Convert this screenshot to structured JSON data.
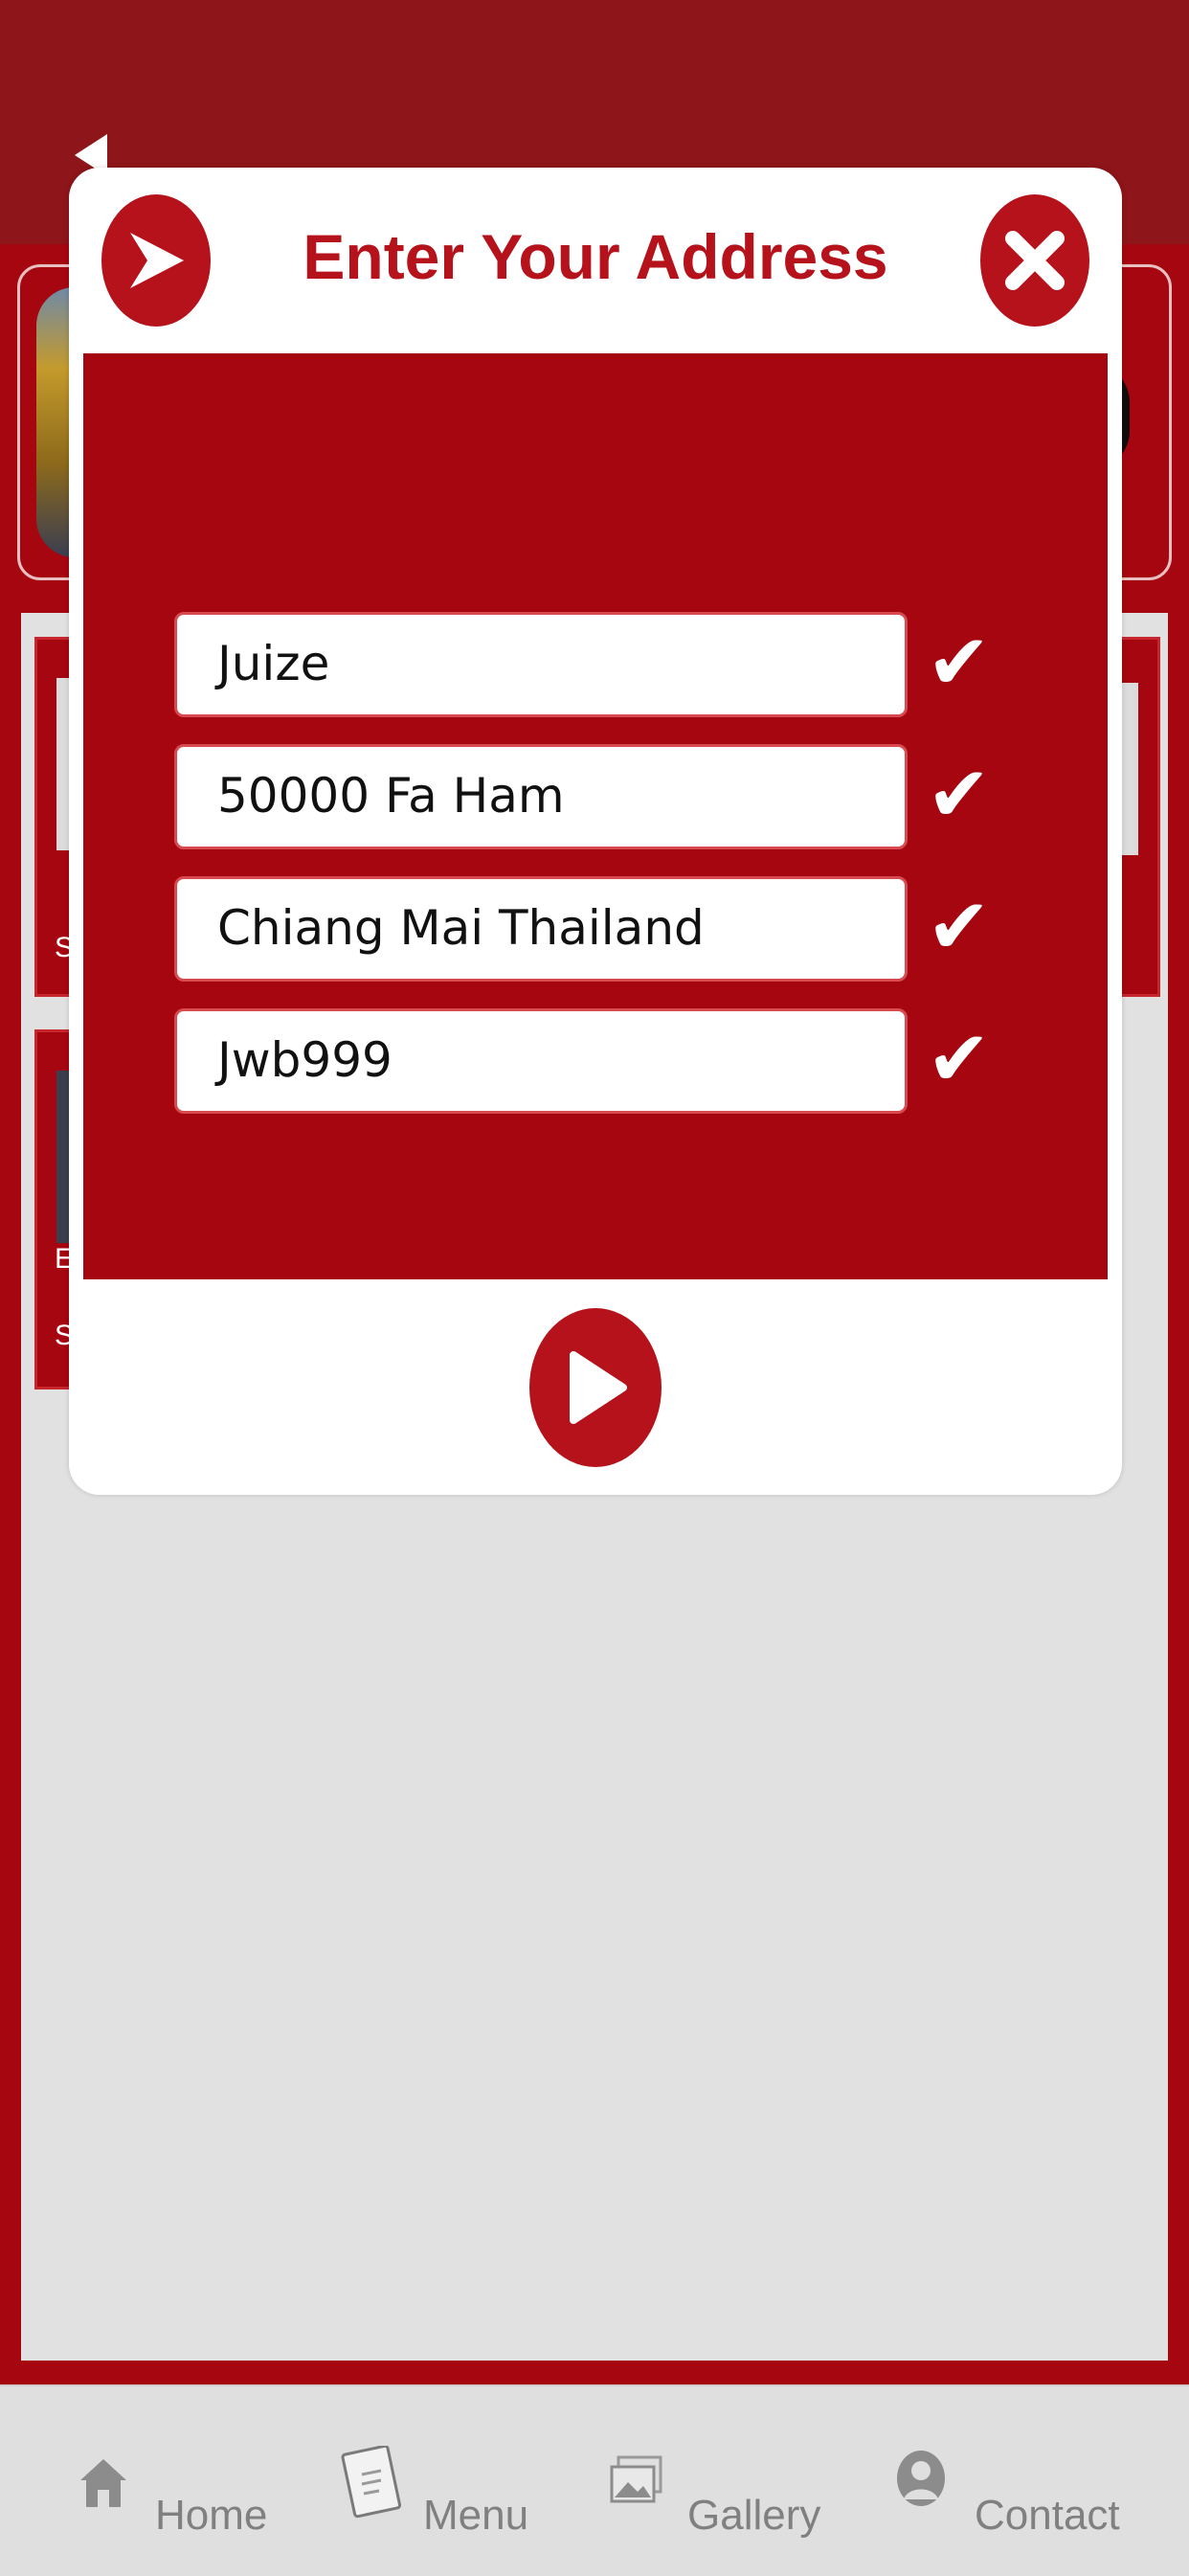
{
  "modal": {
    "title": "Enter Your Address",
    "fields": [
      {
        "value": "Juize"
      },
      {
        "value": "50000 Fa Ham"
      },
      {
        "value": "Chiang Mai Thailand"
      },
      {
        "value": "Jwb999"
      }
    ],
    "check_glyph": "✔"
  },
  "tabbar": {
    "items": [
      {
        "label": "Home",
        "icon": "home-icon"
      },
      {
        "label": "Menu",
        "icon": "menu-book-icon"
      },
      {
        "label": "Gallery",
        "icon": "gallery-icon"
      },
      {
        "label": "Contact",
        "icon": "contact-icon"
      }
    ]
  },
  "background": {
    "card_letters": [
      "S",
      "E",
      "S"
    ]
  },
  "colors": {
    "brand_red": "#a50610",
    "header_red": "#8e1519",
    "accent_red": "#b5121b",
    "tabbar_gray": "#dfdfdf"
  }
}
